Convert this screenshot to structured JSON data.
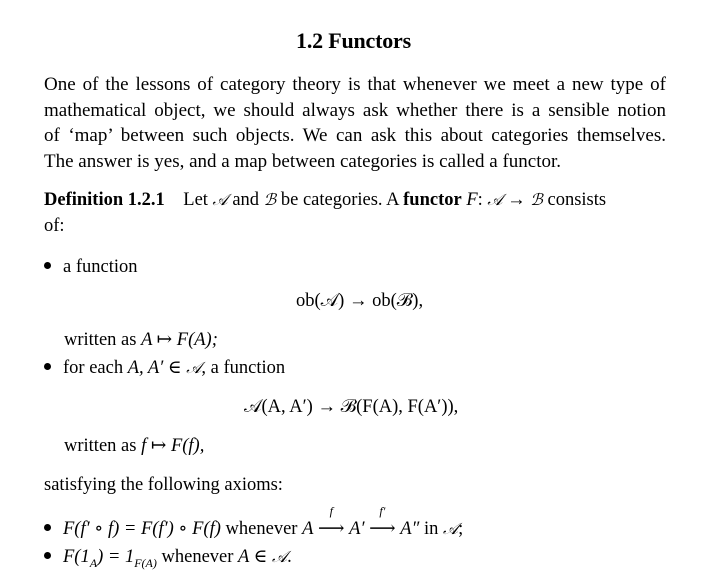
{
  "section": {
    "number": "1.2",
    "title": "Functors",
    "heading": "1.2  Functors"
  },
  "intro": {
    "lines": [
      "One of the lessons of category theory is that whenever we meet a new type of",
      "mathematical object, we should always ask whether there is a sensible notion",
      "of ‘map’ between such objects. We can ask this about categories themselves.",
      "The answer is yes, and a map between categories is called a functor."
    ]
  },
  "definition": {
    "label": "Definition 1.2.1",
    "text_let": "Let",
    "cat_a": "𝒜",
    "text_and": "and",
    "cat_b": "ℬ",
    "text_be": "be categories. A",
    "term": "functor",
    "functor_symbol": "F",
    "colon": ":",
    "arrow": "→",
    "text_consists": "consists",
    "text_of": "of:"
  },
  "items": [
    {
      "intro": "a function",
      "display_formula": {
        "left": "ob(𝒜)",
        "arrow": "→",
        "right": "ob(ℬ),"
      },
      "written_as_prefix": "written as",
      "written_as_formula": "A ↦ F(A);"
    },
    {
      "intro_prefix": "for each",
      "intro_vars": "A, A′ ∈",
      "intro_cat": "𝒜",
      "intro_suffix": ", a function",
      "display_formula": {
        "left": "𝒜(A, A′)",
        "arrow": "→",
        "right": "ℬ(F(A), F(A′)),"
      },
      "written_as_prefix": "written as",
      "written_as_formula": "f ↦ F(f),"
    }
  ],
  "axioms_intro": "satisfying the following axioms:",
  "axioms": [
    {
      "formula": "F(f′ ∘ f) = F(f′) ∘ F(f)",
      "whenever": "whenever",
      "chain_start": "A",
      "arrow1_label": "f",
      "chain_mid": "A′",
      "arrow2_label": "f′",
      "chain_end": "A″",
      "in_text": "in",
      "cat": "𝒜",
      "end": ";"
    },
    {
      "formula_left": "F(1",
      "formula_left_sub": "A",
      "formula_mid": ") = 1",
      "formula_right_sub": "F(A)",
      "whenever": "whenever",
      "condition": "A ∈",
      "cat": "𝒜",
      "end": "."
    }
  ],
  "arrow_glyph": "⟶"
}
